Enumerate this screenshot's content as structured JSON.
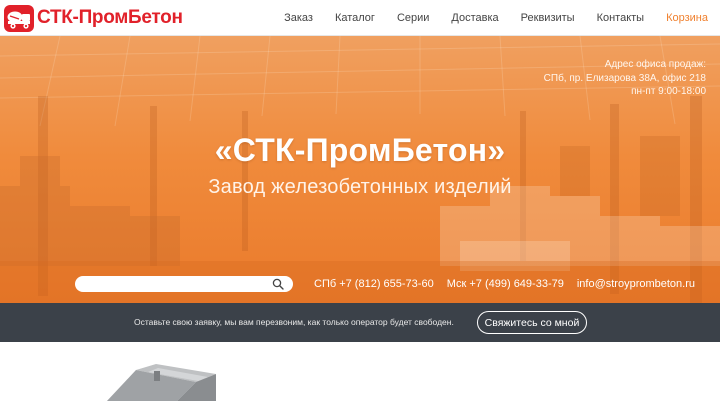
{
  "header": {
    "logo_text": "СТК-ПромБетон",
    "nav": [
      {
        "label": "Заказ"
      },
      {
        "label": "Каталог"
      },
      {
        "label": "Серии"
      },
      {
        "label": "Доставка"
      },
      {
        "label": "Реквизиты"
      },
      {
        "label": "Контакты"
      },
      {
        "label": "Корзина"
      }
    ]
  },
  "hero": {
    "office_lines": [
      "Адрес офиса продаж:",
      "СПб, пр. Елизарова 38А, офис 218",
      "пн-пт 9:00-18:00"
    ],
    "title": "«СТК-ПромБетон»",
    "subtitle": "Завод железобетонных изделий",
    "search": {
      "placeholder": "",
      "value": ""
    },
    "contacts": {
      "phone_spb": "СПб +7 (812) 655-73-60",
      "phone_msk": "Мск +7 (499) 649-33-79",
      "email": "info@stroyprombeton.ru"
    }
  },
  "callback": {
    "text": "Оставьте свою заявку, мы вам перезвоним, как только оператор будет свободен.",
    "button": "Свяжитесь со мной"
  },
  "colors": {
    "brand_red": "#e1212a",
    "accent_orange": "#f0812f",
    "bar_dark": "#3b4149"
  },
  "icons": [
    "truck-icon",
    "search-icon"
  ]
}
